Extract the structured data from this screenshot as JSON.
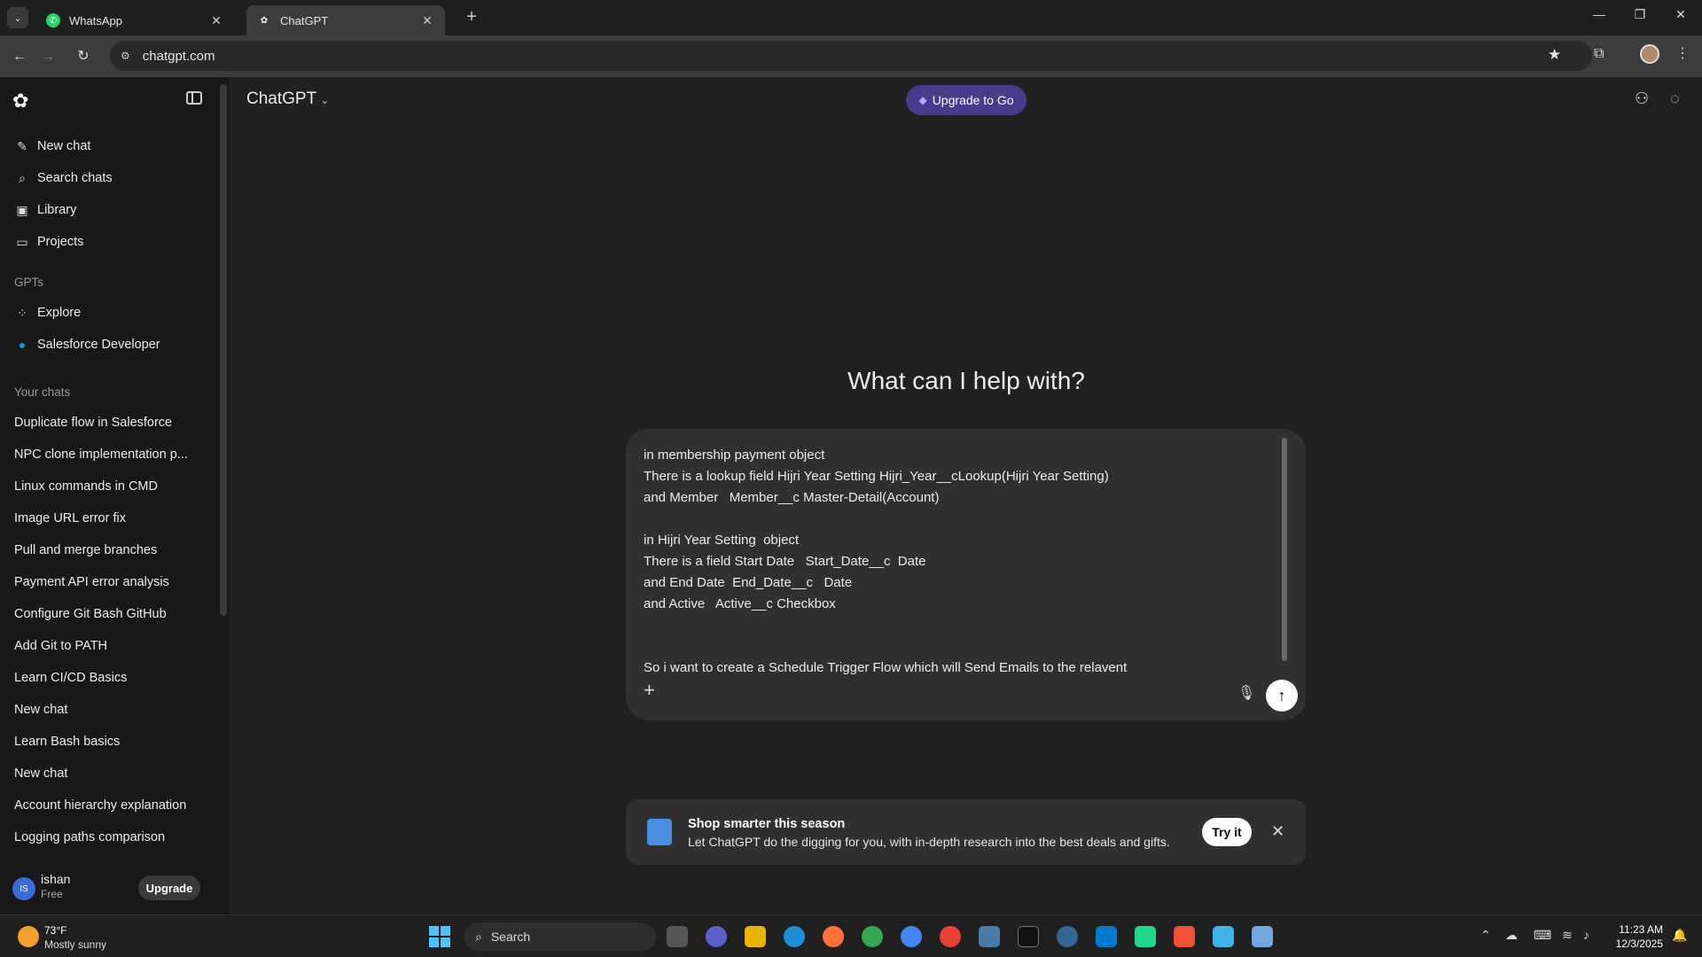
{
  "browser": {
    "tabs": [
      {
        "title": "WhatsApp",
        "favicon_color": "#25d366"
      },
      {
        "title": "ChatGPT",
        "favicon_color": "#ffffff"
      }
    ],
    "url": "chatgpt.com"
  },
  "sidebar": {
    "top_items": [
      "New chat",
      "Search chats",
      "Library",
      "Projects"
    ],
    "gpts_label": "GPTs",
    "gpts": [
      "Explore",
      "Salesforce Developer"
    ],
    "chats_label": "Your chats",
    "chats": [
      "Duplicate flow in Salesforce",
      "NPC clone implementation p...",
      "Linux commands in CMD",
      "Image URL error fix",
      "Pull and merge branches",
      "Payment API error analysis",
      "Configure Git Bash GitHub",
      "Add Git to PATH",
      "Learn CI/CD Basics",
      "New chat",
      "Learn Bash basics",
      "New chat",
      "Account hierarchy explanation",
      "Logging paths comparison"
    ],
    "user": {
      "initials": "IS",
      "name": "ishan",
      "plan": "Free",
      "upgrade": "Upgrade"
    }
  },
  "main": {
    "model": "ChatGPT",
    "upgrade_go": "Upgrade to Go",
    "hero": "What can I help with?",
    "composer_text": "in membership payment object\nThere is a lookup field Hijri Year Setting Hijri_Year__cLookup(Hijri Year Setting)\nand Member   Member__c Master-Detail(Account)\n\nin Hijri Year Setting  object\nThere is a field Start Date   Start_Date__c  Date\nand End Date  End_Date__c   Date\nand Active   Active__c Checkbox\n\n\nSo i want to create a Schedule Trigger Flow which will Send Emails to the relavent ",
    "promo": {
      "title": "Shop smarter this season",
      "desc": "Let ChatGPT do the digging for you, with in-depth research into the best deals and gifts.",
      "cta": "Try it"
    }
  },
  "taskbar": {
    "temp": "73°F",
    "weather": "Mostly sunny",
    "search": "Search",
    "time": "11:23 AM",
    "date": "12/3/2025"
  }
}
